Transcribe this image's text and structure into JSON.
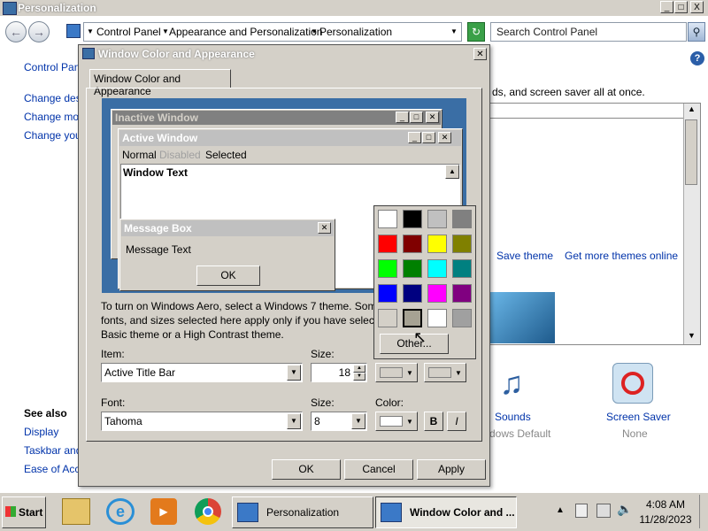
{
  "personalization": {
    "title": "Personalization",
    "caption_buttons": [
      "_",
      "□",
      "X"
    ],
    "breadcrumb": [
      "Control Panel",
      "Appearance and Personalization",
      "Personalization"
    ],
    "search_placeholder": "Search Control Panel",
    "left_links": [
      "Control Pane",
      "Change desk",
      "Change mou",
      "Change your"
    ],
    "see_also_label": "See also",
    "see_also_links": [
      "Display",
      "Taskbar and",
      "Ease of Acce"
    ],
    "body_text": "ds, and screen saver all at once.",
    "save_theme": "Save theme",
    "get_more_themes": "Get more themes online",
    "sounds_label": "Sounds",
    "sounds_value": "dows Default",
    "screensaver_label": "Screen Saver",
    "screensaver_value": "None",
    "help_icon": "?"
  },
  "dialog": {
    "title": "Window Color and Appearance",
    "tab_label": "Window Color and Appearance",
    "preview": {
      "inactive_title": "Inactive Window",
      "active_title": "Active Window",
      "menu_normal": "Normal",
      "menu_disabled": "Disabled",
      "menu_selected": "Selected",
      "window_text": "Window Text",
      "message_title": "Message Box",
      "message_text": "Message Text",
      "ok": "OK"
    },
    "info_line1": "To turn on Windows Aero, select a Windows 7 theme.  Som",
    "info_line2": "fonts, and sizes selected here apply only if you have selecte",
    "info_line3": "Basic theme or a High Contrast theme.",
    "item_label": "Item:",
    "item_value": "Active Title Bar",
    "item_size_label": "Size:",
    "item_size_value": "18",
    "font_label": "Font:",
    "font_value": "Tahoma",
    "font_size_label": "Size:",
    "font_size_value": "8",
    "color_label": "Color:",
    "bold": "B",
    "italic": "I",
    "ok": "OK",
    "cancel": "Cancel",
    "apply": "Apply",
    "palette_other": "Other...",
    "palette_colors": [
      [
        "#ffffff",
        "#000000",
        "#c0c0c0",
        "#808080"
      ],
      [
        "#ff0000",
        "#800000",
        "#ffff00",
        "#808000"
      ],
      [
        "#00ff00",
        "#008000",
        "#00ffff",
        "#008080"
      ],
      [
        "#0000ff",
        "#000080",
        "#ff00ff",
        "#800080"
      ],
      [
        "#d4d0c8",
        "#a6a293",
        "#ffffff",
        "#a0a0a0"
      ]
    ]
  },
  "taskbar": {
    "start": "Start",
    "task1": "Personalization",
    "task2": "Window Color and ...",
    "time": "4:08 AM",
    "date": "11/28/2023"
  }
}
